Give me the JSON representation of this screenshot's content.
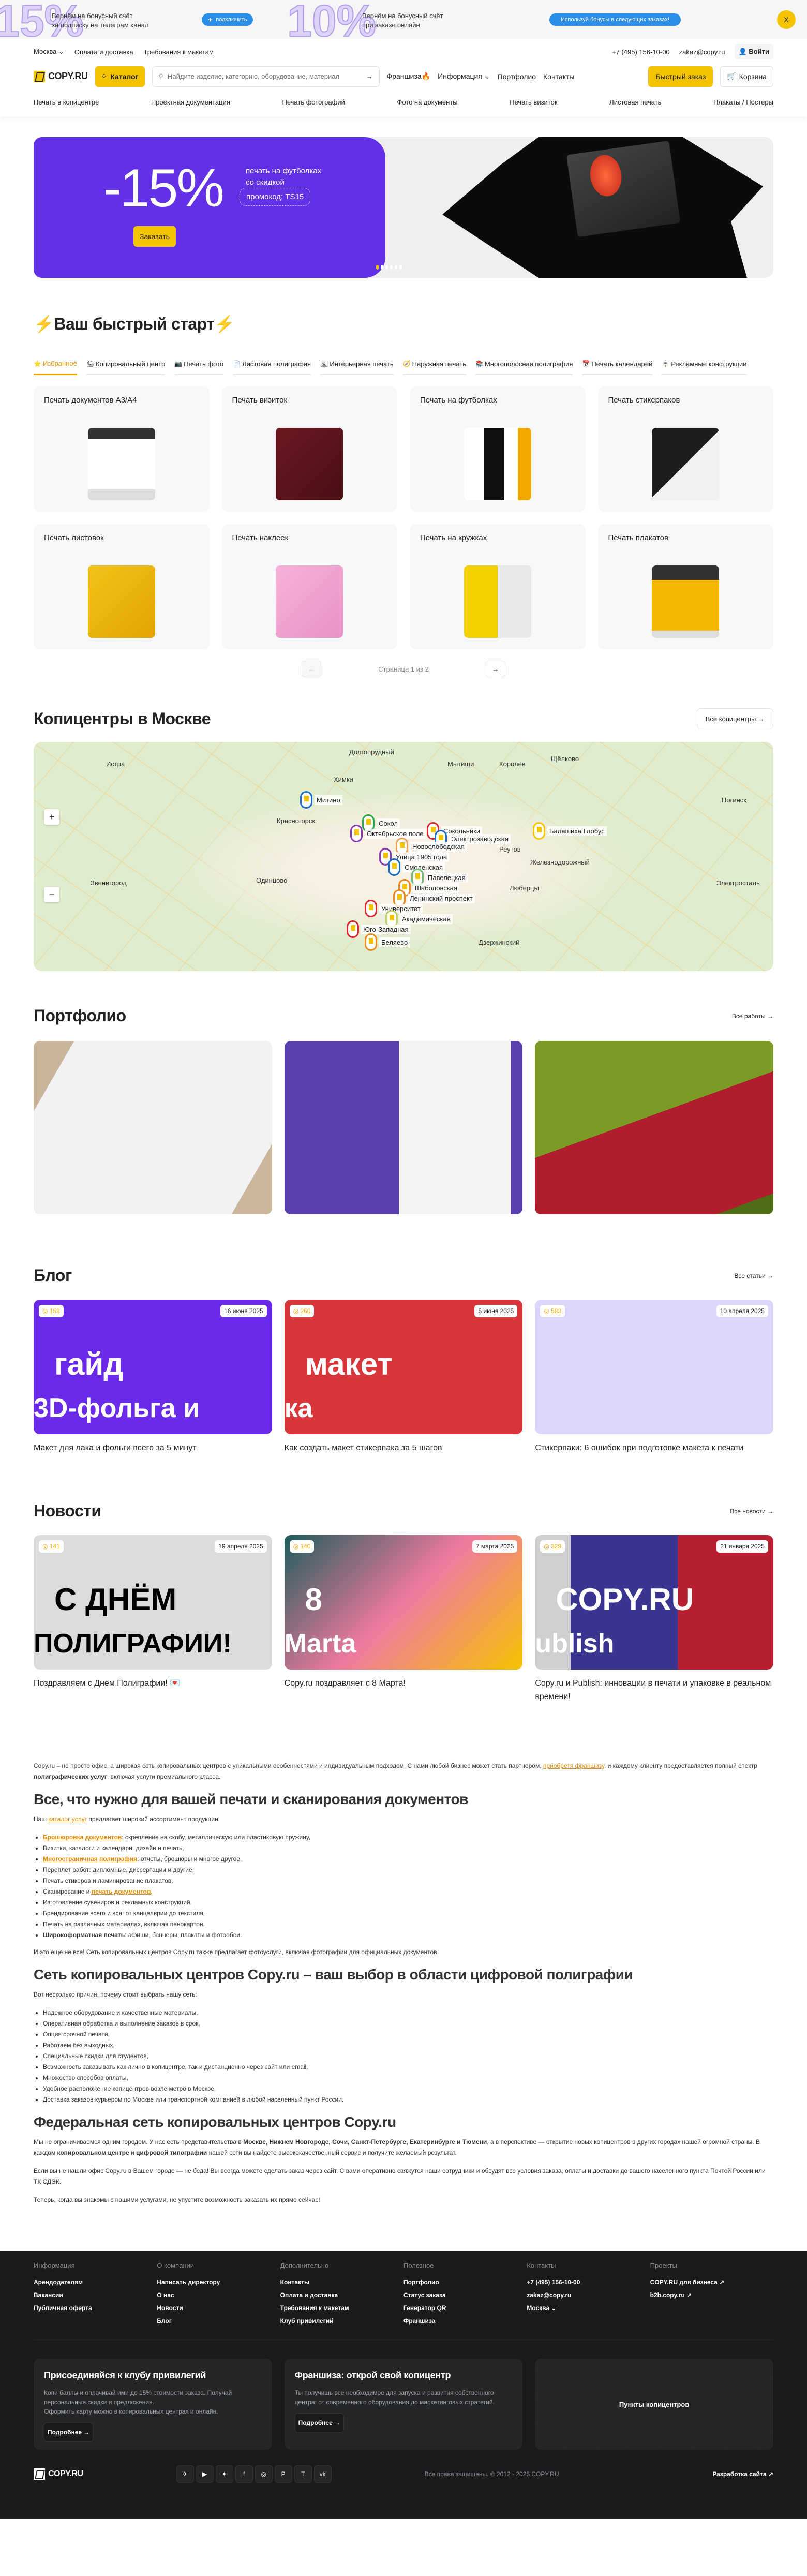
{
  "promo_bar": {
    "left_big": "15%",
    "left_text_1": "Вернём на бонусный счёт",
    "left_text_2": "за подписку на телеграм канал",
    "left_button": "подключить",
    "mid_big": "10%",
    "mid_text_1": "Вернём на бонусный счёт",
    "mid_text_2": "при заказе онлайн",
    "mid_button": "Используй бонусы в следующих заказах!",
    "close": "X"
  },
  "header": {
    "city": "Москва",
    "links": [
      "Оплата и доставка",
      "Требования к макетам"
    ],
    "phone": "+7 (495) 156-10-00",
    "email": "zakaz@copy.ru",
    "login": "Войти",
    "logo": "COPY.RU",
    "catalog": "Каталог",
    "search_placeholder": "Найдите изделие, категорию, оборудование, материал",
    "nav": [
      "Франшиза",
      "Информация",
      "Портфолио",
      "Контакты"
    ],
    "quick_order": "Быстрый заказ",
    "cart": "Корзина",
    "categories": [
      "Печать в копицентре",
      "Проектная документация",
      "Печать фотографий",
      "Фото на документы",
      "Печать визиток",
      "Листовая печать",
      "Плакаты / Постеры"
    ]
  },
  "hero": {
    "discount": "-15%",
    "line1": "печать на футболках",
    "line2": "со скидкой",
    "promo": "промокод: TS15",
    "button": "Заказать",
    "slides": 6,
    "active_slide": 1,
    "accent": "#6331e5"
  },
  "quick_start": {
    "title": "⚡Ваш быстрый старт⚡",
    "tabs": [
      {
        "icon": "⭐",
        "label": "Избранное"
      },
      {
        "icon": "🖨",
        "label": "Копировальный центр"
      },
      {
        "icon": "📷",
        "label": "Печать фото"
      },
      {
        "icon": "📄",
        "label": "Листовая полиграфия"
      },
      {
        "icon": "🖼",
        "label": "Интерьерная печать"
      },
      {
        "icon": "🧭",
        "label": "Наружная печать"
      },
      {
        "icon": "📚",
        "label": "Многополосная полиграфия"
      },
      {
        "icon": "📅",
        "label": "Печать календарей"
      },
      {
        "icon": "🪧",
        "label": "Рекламные конструкции"
      }
    ],
    "cards": [
      "Печать документов А3/А4",
      "Печать визиток",
      "Печать на футболках",
      "Печать стикерпаков",
      "Печать листовок",
      "Печать наклеек",
      "Печать на кружках",
      "Печать плакатов"
    ],
    "pager": "Страница 1 из 2"
  },
  "copycenters": {
    "title": "Копицентры в Москве",
    "all": "Все копицентры",
    "pins": [
      "Митино",
      "Сокол",
      "Октябрьское поле",
      "Сокольники",
      "Электрозаводская",
      "Балашиха Глобус",
      "Новослободская",
      "Улица 1905 года",
      "Смоленская",
      "Павелецкая",
      "Шаболовская",
      "Ленинский проспект",
      "Университет",
      "Академическая",
      "Юго-Западная",
      "Беляево"
    ],
    "towns": [
      "Долгопрудный",
      "Мытищи",
      "Королёв",
      "Щёлково",
      "Химки",
      "Красногорск",
      "Истра",
      "Реутов",
      "Железнодорожный",
      "Одинцово",
      "Люберцы",
      "Электросталь",
      "Ногинск",
      "Звенигород",
      "Дзержинский"
    ]
  },
  "portfolio": {
    "title": "Портфолио",
    "all": "Все работы",
    "items": [
      "wedding-invitation",
      "studio-gift-bag",
      "valentine-card"
    ]
  },
  "blog": {
    "title": "Блог",
    "all": "Все статьи",
    "items": [
      {
        "views": "158",
        "date": "16 июня 2025",
        "title": "Макет для лака и фольги всего за 5 минут",
        "img_text": "гайд",
        "img_text2": "3D-фольга и"
      },
      {
        "views": "260",
        "date": "5 июня 2025",
        "title": "Как создать макет стикерпака за 5 шагов",
        "img_text": "макет",
        "img_text2": "ка"
      },
      {
        "views": "583",
        "date": "10 апреля 2025",
        "title": "Стикерпаки: 6 ошибок при подготовке макета к печати",
        "img_text": "",
        "img_text2": ""
      }
    ]
  },
  "news": {
    "title": "Новости",
    "all": "Все новости",
    "items": [
      {
        "views": "141",
        "date": "19 апреля 2025",
        "title": "Поздравляем с Днем Полиграфии! 💌",
        "img_text": "С ДНЁМ",
        "img_text2": "ПОЛИГРАФИИ!"
      },
      {
        "views": "140",
        "date": "7 марта 2025",
        "title": "Copy.ru поздравляет с 8 Марта!",
        "img_text": "8",
        "img_text2": "Marta"
      },
      {
        "views": "329",
        "date": "21 января 2025",
        "title": "Copy.ru и Publish: инновации в печати и упаковке в реальном времени!",
        "img_text": "COPY.RU",
        "img_text2": "ublish"
      }
    ]
  },
  "seo": {
    "intro_1": "Copy.ru – не просто офис, а широкая сеть копировальных центров с уникальными особенностями и индивидуальным подходом. С нами любой бизнес может стать партнером, ",
    "intro_link": "приобретя франшизу",
    "intro_2": ", и каждому клиенту предоставляется полный спектр ",
    "intro_bold": "полиграфических услуг",
    "intro_3": ", включая услуги премиального класса.",
    "h1": "Все, что нужно для вашей печати и сканирования документов",
    "p1_a": "Наш ",
    "p1_link": "каталог услуг",
    "p1_b": " предлагает широкий ассортимент продукции:",
    "list1": [
      {
        "link": "Брошюровка документов",
        "text": ": скрепление на скобу, металлическую или пластиковую пружину,"
      },
      {
        "text": "Визитки, каталоги и календари: дизайн и печать,"
      },
      {
        "link": "Многостраничная полиграфия",
        "text": ": отчеты, брошюры и многое другое,"
      },
      {
        "text": "Переплет работ: дипломные, диссертации и другие,"
      },
      {
        "text": "Печать стикеров и ламинирование плакатов,"
      },
      {
        "pre": "Сканирование и ",
        "link": "печать документов,"
      },
      {
        "text": "Изготовление сувениров и рекламных конструкций,"
      },
      {
        "text": "Брендирование всего и вся: от канцелярии до текстиля,"
      },
      {
        "text": "Печать на различных материалах, включая пенокартон,"
      },
      {
        "bold": "Широкоформатная печать",
        "text": ": афиши, баннеры, плакаты и фотообои."
      }
    ],
    "p2": "И это еще не все! Сеть копировальных центров Copy.ru также предлагает фотоуслуги, включая фотографии для официальных документов.",
    "h2": "Сеть копировальных центров Copy.ru – ваш выбор в области цифровой полиграфии",
    "p3": "Вот несколько причин, почему стоит выбрать нашу сеть:",
    "list2": [
      "Надежное оборудование и качественные материалы,",
      "Оперативная обработка и выполнение заказов в срок,",
      "Опция срочной печати,",
      "Работаем без выходных,",
      "Специальные скидки для студентов,",
      "Возможность заказывать как лично в копицентре, так и дистанционно через сайт или email,",
      "Множество способов оплаты,",
      "Удобное расположение копицентров возле метро в Москве,",
      "Доставка заказов курьером по Москве или транспортной компанией в любой населенный пункт России."
    ],
    "h3": "Федеральная сеть копировальных центров Copy.ru",
    "p4_a": "Мы не ограничиваемся одним городом. У нас есть представительства в ",
    "p4_bold": "Москве, Нижнем Новгороде, Сочи, Санкт-Петербурге, Екатеринбурге и Тюмени",
    "p4_b": ", а в перспективе — открытие новых копицентров в других городах нашей огромной страны. В каждом ",
    "p4_bold2": "копировальном центре",
    "p4_c": " и ",
    "p4_bold3": "цифровой типографии",
    "p4_d": " нашей сети вы найдете высококачественный сервис и получите желаемый результат.",
    "p5": "Если вы не нашли офис Copy.ru в Вашем городе — не беда! Вы всегда можете сделать заказ через сайт. С вами оперативно свяжутся наши сотрудники и обсудят все условия заказа, оплаты и доставки до вашего населенного пункта Почтой России или ТК СДЭК.",
    "p6": "Теперь, когда вы знакомы с нашими услугами, не упустите возможность заказать их прямо сейчас!"
  },
  "footer": {
    "columns": [
      {
        "title": "Информация",
        "items": [
          "Арендодателям",
          "Вакансии",
          "Публичная оферта"
        ]
      },
      {
        "title": "О компании",
        "items": [
          "Написать директору",
          "О нас",
          "Новости",
          "Блог"
        ]
      },
      {
        "title": "Дополнительно",
        "items": [
          "Контакты",
          "Оплата и доставка",
          "Требования к макетам",
          "Клуб привилегий"
        ]
      },
      {
        "title": "Полезное",
        "items": [
          "Портфолио",
          "Статус заказа",
          "Генератор QR",
          "Франшиза"
        ]
      },
      {
        "title": "Контакты",
        "items": [
          "+7 (495) 156-10-00",
          "zakaz@copy.ru",
          "Москва ⌄"
        ]
      },
      {
        "title": "Проекты",
        "items": [
          "COPY.RU для бизнеса ↗",
          "b2b.copy.ru ↗"
        ]
      }
    ],
    "club": {
      "title": "Присоединяйся к клубу привилегий",
      "text": "Копи баллы и оплачивай ими до 15% стоимости заказа. Получай персональные скидки и предложения.",
      "text2": "Оформить карту можно в копировальных центрах и онлайн.",
      "button": "Подробнее →"
    },
    "franchise": {
      "title": "Франшиза: открой свой копицентр",
      "text": "Ты получишь все необходимое для запуска и развития собственного центра: от современного оборудования до маркетинговых стратегий.",
      "button": "Подробнее →"
    },
    "points": "Пункты копицентров",
    "logo": "COPY.RU",
    "socials": [
      "telegram",
      "youtube",
      "dzen",
      "facebook",
      "instagram",
      "pinterest",
      "tenchat",
      "vk"
    ],
    "copyright": "Все права защищены. © 2012 - 2025 COPY.RU",
    "dev": "Разработка сайта ↗"
  }
}
